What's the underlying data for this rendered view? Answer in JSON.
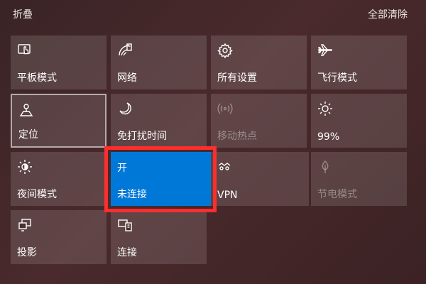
{
  "header": {
    "collapse_label": "折叠",
    "clear_all_label": "全部清除"
  },
  "tiles": {
    "tablet_mode": {
      "label": "平板模式",
      "icon": "tablet-mode-icon"
    },
    "network": {
      "label": "网络",
      "icon": "network-icon"
    },
    "all_settings": {
      "label": "所有设置",
      "icon": "gear-icon"
    },
    "airplane_mode": {
      "label": "飞行模式",
      "icon": "airplane-icon"
    },
    "location": {
      "label": "定位",
      "icon": "location-icon"
    },
    "focus_assist": {
      "label": "免打扰时间",
      "icon": "moon-icon"
    },
    "mobile_hotspot": {
      "label": "移动热点",
      "icon": "hotspot-icon",
      "state": "disabled"
    },
    "brightness": {
      "label": "99%",
      "icon": "brightness-icon",
      "value_percent": 99
    },
    "night_light": {
      "label": "夜间模式",
      "icon": "night-light-icon"
    },
    "bluetooth": {
      "status_top": "开",
      "label": "未连接",
      "state": "on"
    },
    "vpn": {
      "label": "VPN",
      "icon": "vpn-icon"
    },
    "battery_saver": {
      "label": "节电模式",
      "icon": "battery-saver-icon",
      "state": "disabled"
    },
    "project": {
      "label": "投影",
      "icon": "project-icon"
    },
    "connect": {
      "label": "连接",
      "icon": "connect-icon"
    }
  },
  "colors": {
    "active_tile": "#0078d7",
    "highlight": "#ff2e2e",
    "tile_bg": "rgba(255,255,255,0.13)"
  }
}
